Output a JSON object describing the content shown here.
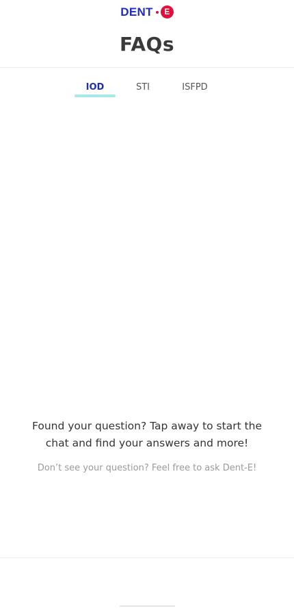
{
  "header": {
    "logo": {
      "text": "DENT",
      "badge_letter": "E",
      "text_color": "#1e2bc8",
      "accent_color": "#e0103a"
    },
    "title": "FAQs"
  },
  "tabs": {
    "items": [
      {
        "label": "IOD",
        "active": true
      },
      {
        "label": "STI",
        "active": false
      },
      {
        "label": "ISFPD",
        "active": false
      }
    ],
    "underline_color": "#a6e9ea"
  },
  "prompt": {
    "main": "Found your question? Tap away to start the chat and find your answers and more!",
    "sub": "Don’t see your question? Feel free to ask Dent-E!"
  }
}
